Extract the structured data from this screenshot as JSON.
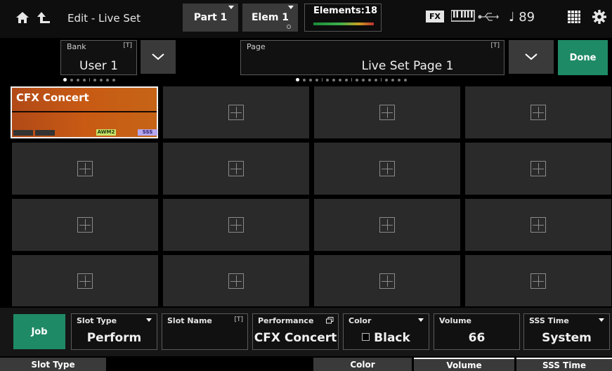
{
  "header": {
    "title": "Edit - Live Set",
    "part_label": "Part 1",
    "elem_label": "Elem 1",
    "elements_label": "Elements:18",
    "fx_label": "FX",
    "tempo": "♩ 89"
  },
  "bank": {
    "label": "Bank",
    "tag": "[T]",
    "value": "User 1"
  },
  "page": {
    "label": "Page",
    "tag": "[T]",
    "value": "Live Set Page  1"
  },
  "done_label": "Done",
  "slots": [
    {
      "name": "CFX Concert",
      "awm_label": "AWM2",
      "sss_label": "SSS"
    }
  ],
  "params": {
    "job_label": "Job",
    "slot_type": {
      "label": "Slot Type",
      "value": "Perform"
    },
    "slot_name": {
      "label": "Slot Name",
      "tag": "[T]",
      "value": ""
    },
    "performance": {
      "label": "Performance",
      "value": "CFX Concert"
    },
    "color": {
      "label": "Color",
      "value": "Black"
    },
    "volume": {
      "label": "Volume",
      "value": "66"
    },
    "sss_time": {
      "label": "SSS Time",
      "value": "System"
    }
  },
  "footer_tabs": [
    "Slot Type",
    "Color",
    "Volume",
    "SSS Time"
  ]
}
